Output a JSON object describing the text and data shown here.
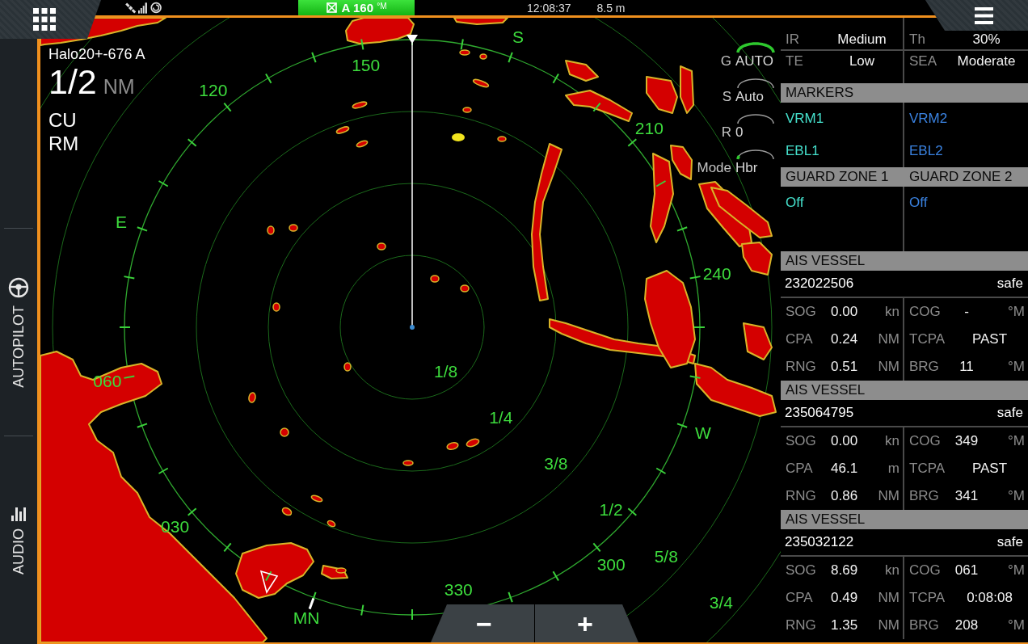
{
  "top_bar": {
    "heading": "A 160 $^{°M}$",
    "time": "12:08:37",
    "depth": "8.5 m"
  },
  "sidebar": [
    {
      "label": "AUTOPILOT",
      "kind": "autopilot"
    },
    {
      "label": "AUDIO",
      "kind": "audio"
    }
  ],
  "radar": {
    "source": "Halo20+-676 A",
    "range": "1/2",
    "range_unit": "NM",
    "orientation": "CU",
    "motion": "RM",
    "controls": [
      {
        "label": "G",
        "value": "AUTO",
        "level": 1
      },
      {
        "label": "S",
        "value": "Auto",
        "level": 0
      },
      {
        "label": "R",
        "value": "0",
        "level": 0
      },
      {
        "label": "Mode",
        "value": "Hbr",
        "level": 0.12
      }
    ],
    "bearing_labels": [
      "150",
      "S",
      "210",
      "240",
      "W",
      "300",
      "330",
      "MN",
      "030",
      "060",
      "E",
      "120"
    ],
    "range_labels": [
      "1/8",
      "1/4",
      "3/8",
      "1/2",
      "5/8",
      "3/4"
    ],
    "zoom_buttons": [
      "−",
      "+"
    ]
  },
  "panel": {
    "settings": [
      {
        "label": "IR",
        "value": "Medium"
      },
      {
        "label": "Th",
        "value": "30%"
      },
      {
        "label": "TE",
        "value": "Low"
      },
      {
        "label": "SEA",
        "value": "Moderate"
      }
    ],
    "markers": {
      "title": "MARKERS",
      "items": [
        {
          "label": "VRM1",
          "color": "#45e0cc"
        },
        {
          "label": "VRM2",
          "color": "#3a82e0"
        },
        {
          "label": "EBL1",
          "color": "#45e0cc"
        },
        {
          "label": "EBL2",
          "color": "#3a82e0"
        }
      ]
    },
    "guard_zones": [
      {
        "title": "GUARD ZONE 1",
        "value": "Off",
        "color": "#45e0cc"
      },
      {
        "title": "GUARD ZONE 2",
        "value": "Off",
        "color": "#3a82e0"
      }
    ],
    "ais_vessels": [
      {
        "title": "AIS VESSEL",
        "id": "232022506",
        "status": "safe",
        "fields": [
          {
            "label": "SOG",
            "value": "0.00",
            "unit": "kn"
          },
          {
            "label": "COG",
            "value": "-",
            "unit": "°M"
          },
          {
            "label": "CPA",
            "value": "0.24",
            "unit": "NM"
          },
          {
            "label": "TCPA",
            "value": "PAST"
          },
          {
            "label": "RNG",
            "value": "0.51",
            "unit": "NM"
          },
          {
            "label": "BRG",
            "value": "11",
            "unit": "°M"
          }
        ]
      },
      {
        "title": "AIS VESSEL",
        "id": "235064795",
        "status": "safe",
        "fields": [
          {
            "label": "SOG",
            "value": "0.00",
            "unit": "kn"
          },
          {
            "label": "COG",
            "value": "349",
            "unit": "°M"
          },
          {
            "label": "CPA",
            "value": "46.1",
            "unit": "m"
          },
          {
            "label": "TCPA",
            "value": "PAST"
          },
          {
            "label": "RNG",
            "value": "0.86",
            "unit": "NM"
          },
          {
            "label": "BRG",
            "value": "341",
            "unit": "°M"
          }
        ]
      },
      {
        "title": "AIS VESSEL",
        "id": "235032122",
        "status": "safe",
        "fields": [
          {
            "label": "SOG",
            "value": "8.69",
            "unit": "kn"
          },
          {
            "label": "COG",
            "value": "061",
            "unit": "°M"
          },
          {
            "label": "CPA",
            "value": "0.49",
            "unit": "NM"
          },
          {
            "label": "TCPA",
            "value": "0:08:08"
          },
          {
            "label": "RNG",
            "value": "1.35",
            "unit": "NM"
          },
          {
            "label": "BRG",
            "value": "208",
            "unit": "°M"
          }
        ]
      }
    ]
  }
}
